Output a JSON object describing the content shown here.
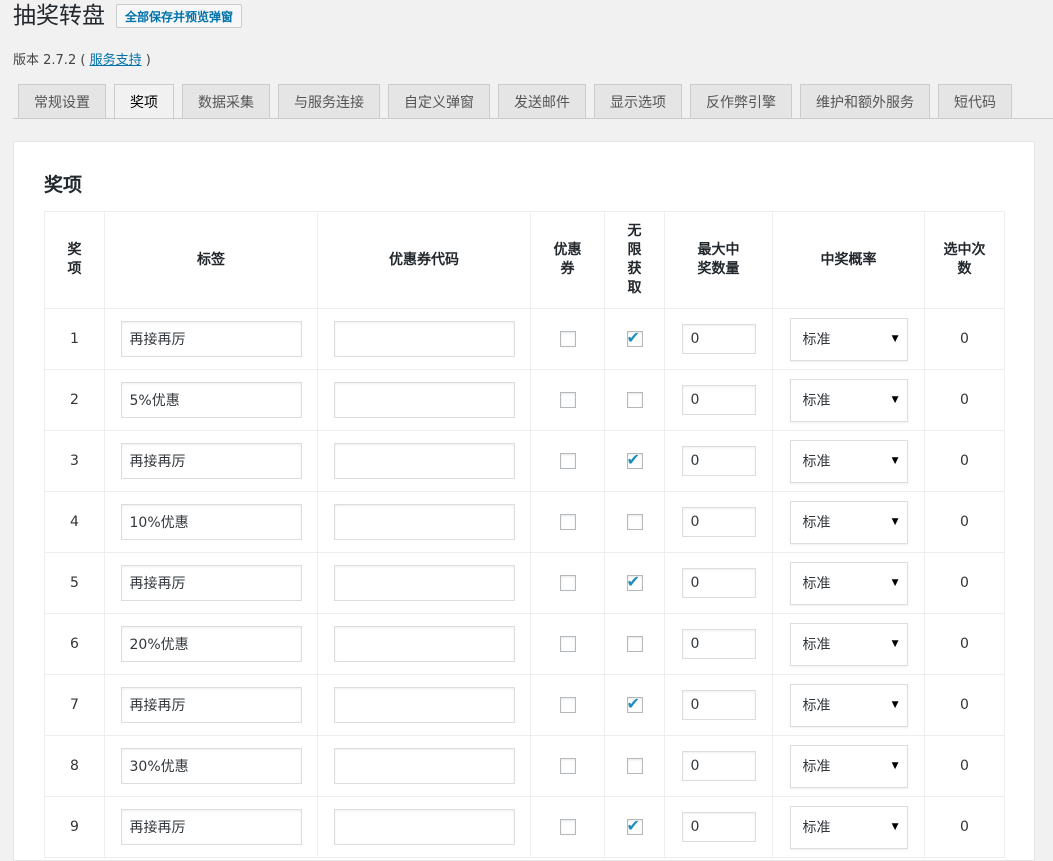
{
  "header": {
    "title": "抽奖转盘",
    "save_button": "全部保存并预览弹窗",
    "version_prefix": "版本 2.7.2 (",
    "support_link": "服务支持",
    "version_suffix": ")"
  },
  "tabs": [
    {
      "label": "常规设置",
      "active": false
    },
    {
      "label": "奖项",
      "active": true
    },
    {
      "label": "数据采集",
      "active": false
    },
    {
      "label": "与服务连接",
      "active": false
    },
    {
      "label": "自定义弹窗",
      "active": false
    },
    {
      "label": "发送邮件",
      "active": false
    },
    {
      "label": "显示选项",
      "active": false
    },
    {
      "label": "反作弊引擎",
      "active": false
    },
    {
      "label": "维护和额外服务",
      "active": false
    },
    {
      "label": "短代码",
      "active": false
    }
  ],
  "section": {
    "title": "奖项"
  },
  "table": {
    "columns": [
      "奖项",
      "标签",
      "优惠券代码",
      "优惠券",
      "无限获取",
      "最大中奖数量",
      "中奖概率",
      "选中次数"
    ],
    "rows": [
      {
        "index": "1",
        "label": "再接再厉",
        "coupon_code": "",
        "coupon": false,
        "unlimited": true,
        "max": "0",
        "probability": "标准",
        "picked": "0"
      },
      {
        "index": "2",
        "label": "5%优惠",
        "coupon_code": "",
        "coupon": false,
        "unlimited": false,
        "max": "0",
        "probability": "标准",
        "picked": "0"
      },
      {
        "index": "3",
        "label": "再接再厉",
        "coupon_code": "",
        "coupon": false,
        "unlimited": true,
        "max": "0",
        "probability": "标准",
        "picked": "0"
      },
      {
        "index": "4",
        "label": "10%优惠",
        "coupon_code": "",
        "coupon": false,
        "unlimited": false,
        "max": "0",
        "probability": "标准",
        "picked": "0"
      },
      {
        "index": "5",
        "label": "再接再厉",
        "coupon_code": "",
        "coupon": false,
        "unlimited": true,
        "max": "0",
        "probability": "标准",
        "picked": "0"
      },
      {
        "index": "6",
        "label": "20%优惠",
        "coupon_code": "",
        "coupon": false,
        "unlimited": false,
        "max": "0",
        "probability": "标准",
        "picked": "0"
      },
      {
        "index": "7",
        "label": "再接再厉",
        "coupon_code": "",
        "coupon": false,
        "unlimited": true,
        "max": "0",
        "probability": "标准",
        "picked": "0"
      },
      {
        "index": "8",
        "label": "30%优惠",
        "coupon_code": "",
        "coupon": false,
        "unlimited": false,
        "max": "0",
        "probability": "标准",
        "picked": "0"
      },
      {
        "index": "9",
        "label": "再接再厉",
        "coupon_code": "",
        "coupon": false,
        "unlimited": true,
        "max": "0",
        "probability": "标准",
        "picked": "0"
      }
    ]
  },
  "colors": {
    "accent": "#0073aa",
    "check": "#1e8cbe"
  }
}
